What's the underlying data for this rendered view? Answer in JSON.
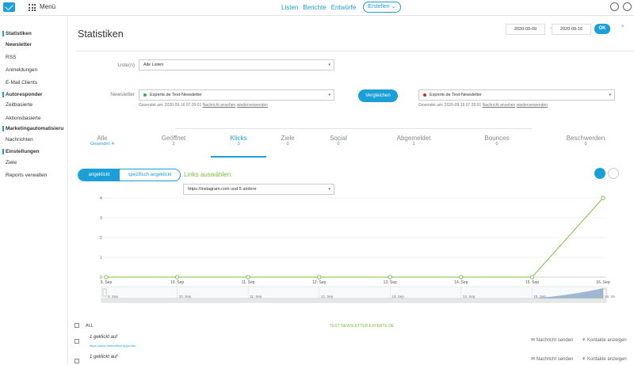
{
  "topbar": {
    "menu_label": "Menü",
    "nav": [
      "Listen",
      "Berichte",
      "Entwürfe"
    ],
    "create_label": "Erstellen ⌄"
  },
  "sidebar": {
    "items": [
      {
        "label": "Statistiken",
        "active": true,
        "bar": true
      },
      {
        "label": "Newsletter",
        "active": true
      },
      {
        "label": "RSS"
      },
      {
        "label": "Anmeldungen"
      },
      {
        "label": "E-Mail Clients"
      },
      {
        "label": "Autoresponder",
        "active": true,
        "bar": true
      },
      {
        "label": "Zeitbasierte"
      },
      {
        "label": "Aktionsbasierte"
      },
      {
        "label": "Marketingautomatisieru",
        "active": true,
        "bar": true
      },
      {
        "label": "Nachrichten"
      },
      {
        "label": "Einstellungen",
        "active": true,
        "bar": true
      },
      {
        "label": "Ziele"
      },
      {
        "label": "Reports verwalten"
      }
    ]
  },
  "header": {
    "title": "Statistiken",
    "date_from": "2020-09-09",
    "date_to": "2020-09-16",
    "ok_label": "OK",
    "close": "×"
  },
  "filters": {
    "lists_label": "Liste(n)",
    "lists_value": "Alle Listen",
    "newsletter_label": "Newsletter",
    "left_newsletter": "Experte.de Test-Newsletter",
    "left_sent": "Gesendet am: 2020-09-16 07:20:01",
    "right_newsletter": "Experte.de Test-Newsletter",
    "right_sent": "Gesendet am: 2020-09-16 07:20:01",
    "view_link": "Nachricht ansehen",
    "reuse_link": "wiederverwenden",
    "compare_label": "Vergleichen"
  },
  "stats": [
    {
      "label": "Alle",
      "value": "Gesendet: 4"
    },
    {
      "label": "Geöffnet",
      "value": "2"
    },
    {
      "label": "Klicks",
      "value": "3",
      "active": true
    },
    {
      "label": "Ziele",
      "value": "0"
    },
    {
      "label": "Social",
      "value": "0"
    },
    {
      "label": "Abgemeldet",
      "value": "1"
    },
    {
      "label": "Bounces",
      "value": "0"
    },
    {
      "label": "Beschwerden",
      "value": "0"
    }
  ],
  "clicks": {
    "toggle_on": "angeklickt",
    "toggle_off": "spezifisch angeklickt",
    "links_title": "Links auswählen:",
    "links_value": "https://instagram.com und 5 andere"
  },
  "chart_data": {
    "type": "line",
    "categories": [
      "9. Sep",
      "10. Sep",
      "11. Sep",
      "12. Sep",
      "13. Sep",
      "14. Sep",
      "15. Sep",
      "16. Sep"
    ],
    "values": [
      0,
      0,
      0,
      0,
      0,
      0,
      0,
      4
    ],
    "y_ticks": [
      "0",
      "1",
      "2",
      "3",
      "4"
    ],
    "ylim": [
      0,
      4
    ],
    "grid": true,
    "color": "#7cc142",
    "navigator_labels": [
      "9. Sep",
      "10. Sep",
      "11. Sep",
      "12. Sep",
      "13. Sep",
      "14. Sep",
      "15. Sep",
      "16. Se"
    ]
  },
  "list": {
    "all_label": "ALL",
    "newsletter_head": "TEST NEWSLETTER EXPERTE.DE",
    "rows": [
      {
        "title": "1 geklickt auf",
        "url": "https://www.homeoffice-tipps.info"
      },
      {
        "title": "1 geklickt auf",
        "url": ""
      }
    ],
    "send_label": "Nachricht senden",
    "contacts_label": "Kontakte anzeigen"
  }
}
